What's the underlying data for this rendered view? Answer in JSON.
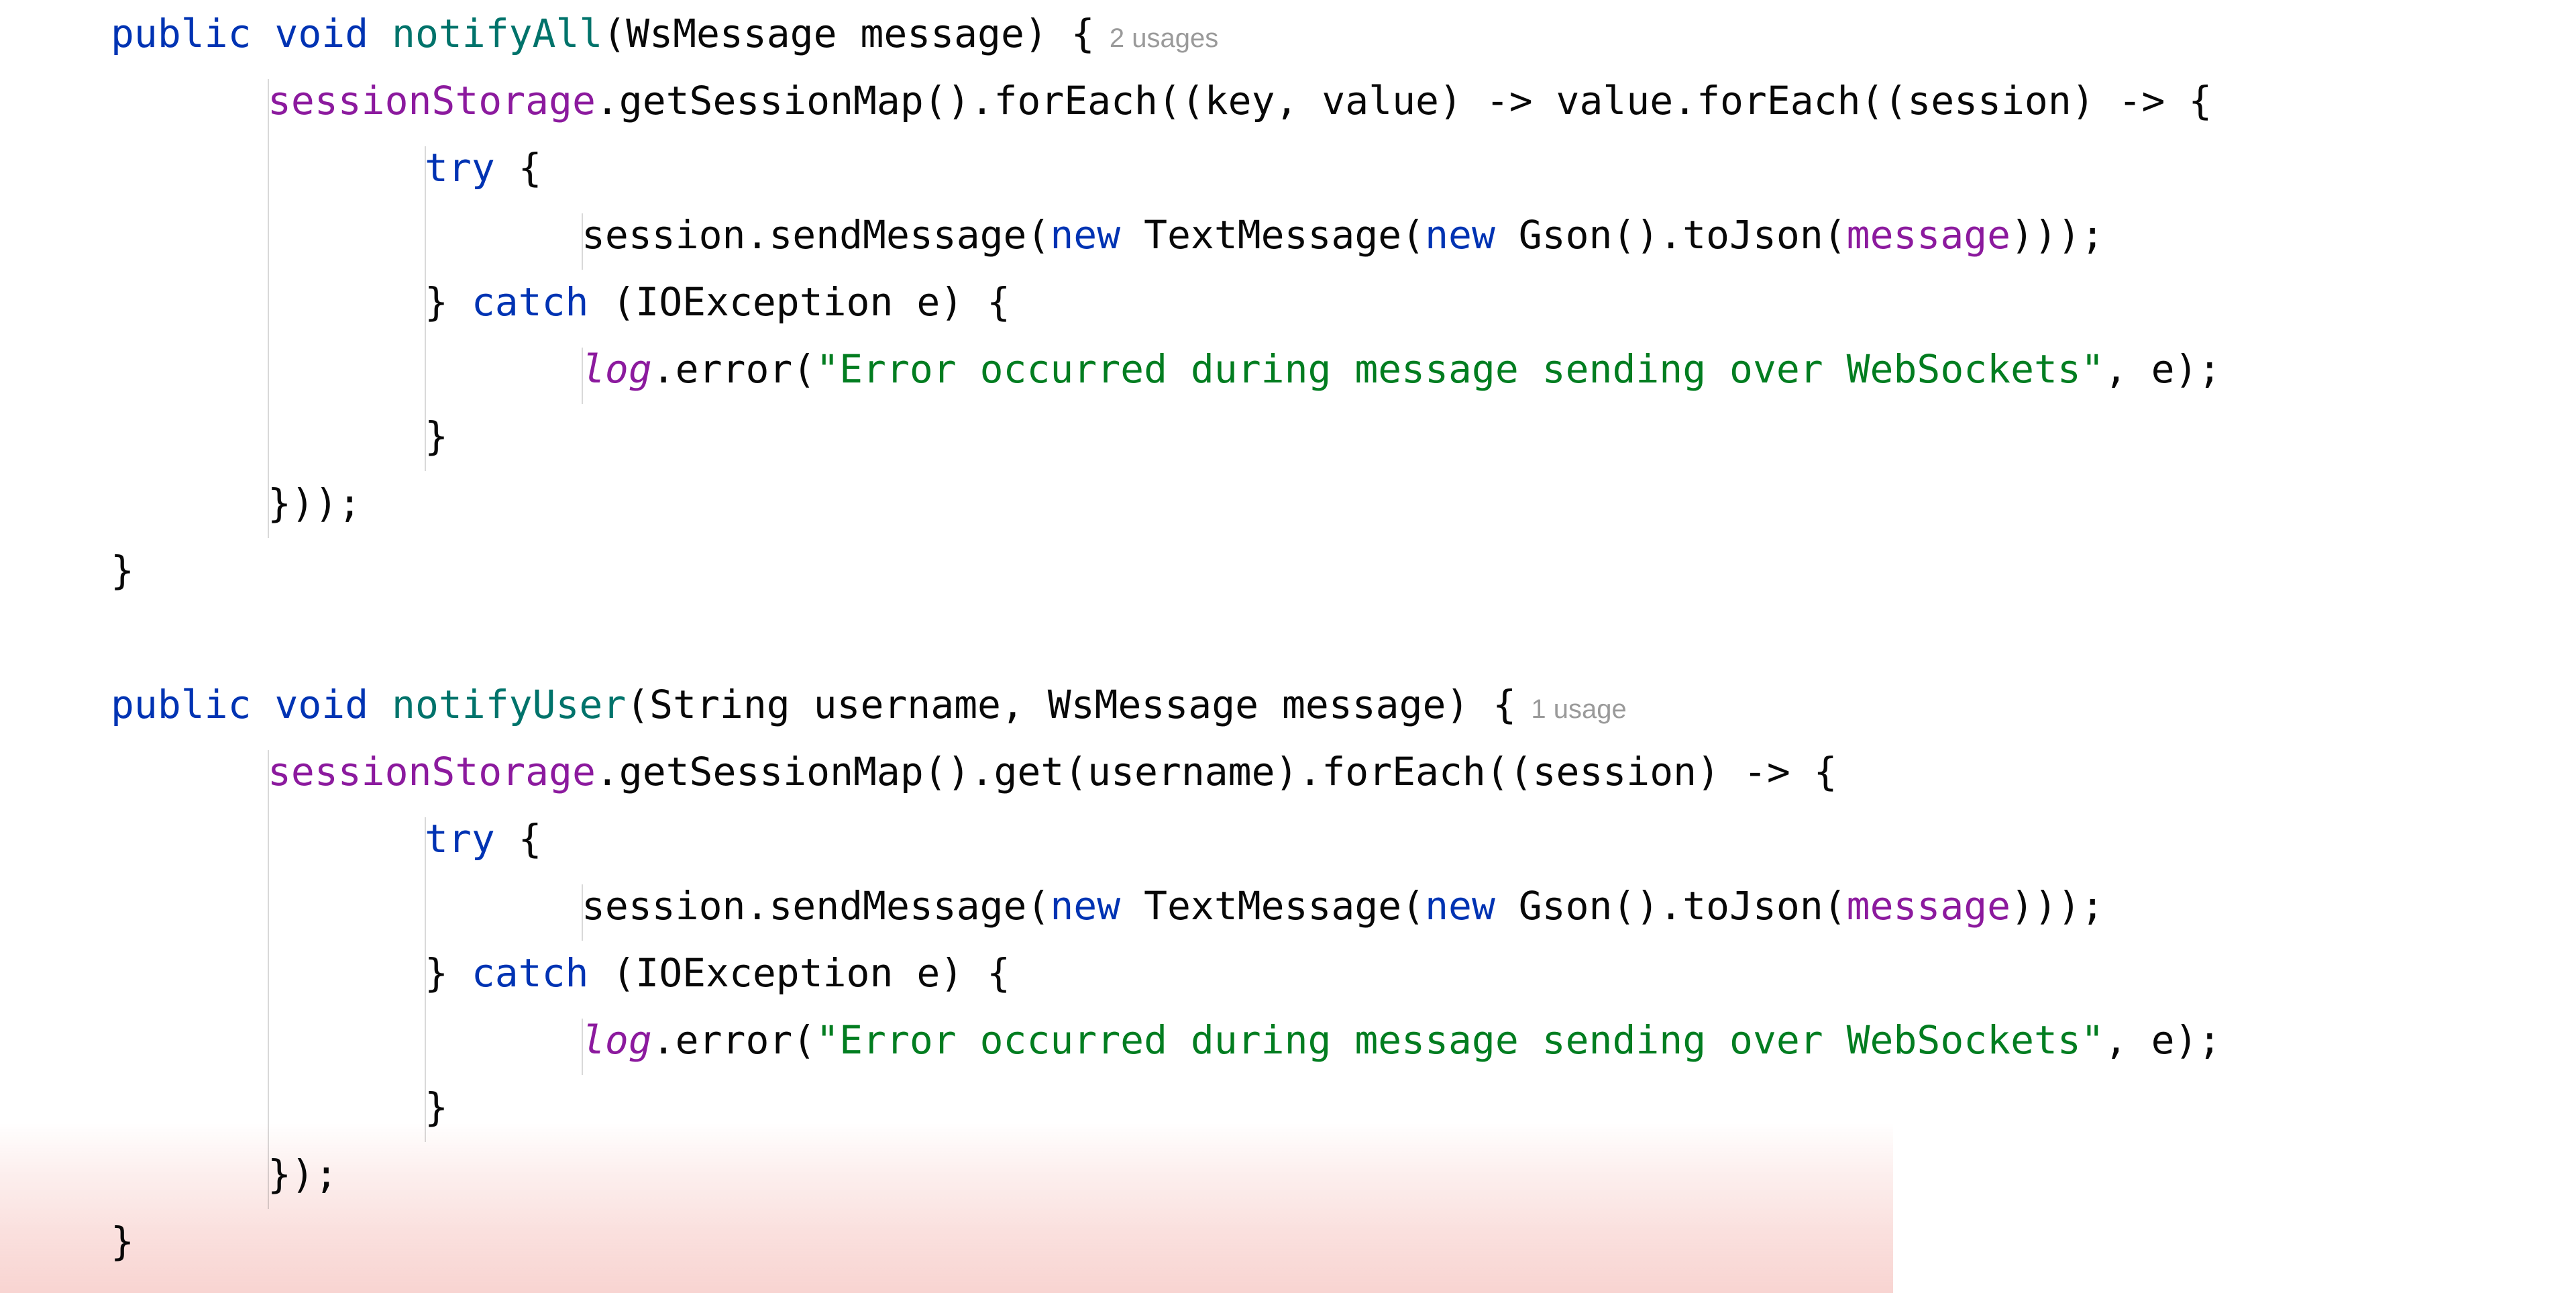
{
  "editor": {
    "background_color": "#ffffff",
    "default_text_color": "#080808",
    "indent_guide_color": "#d9d9d9",
    "syntax_colors": {
      "keyword": "#0033b3",
      "method_declaration": "#00736b",
      "field": "#8c1a9e",
      "static_field": "#8c1a9e",
      "string": "#027d20",
      "plain": "#080808",
      "inlay_hint": "#9a9a9a"
    },
    "overlay": {
      "name": "pink-gradient-highlight",
      "top_color": "#ffffff",
      "bottom_color": "#f8d4d1"
    }
  },
  "code": {
    "lines": [
      {
        "id": "line-1",
        "indent": 0,
        "tokens": [
          {
            "t": "public",
            "c": "kw"
          },
          {
            "t": " ",
            "c": "plain"
          },
          {
            "t": "void",
            "c": "kw"
          },
          {
            "t": " ",
            "c": "plain"
          },
          {
            "t": "notifyAll",
            "c": "method"
          },
          {
            "t": "(WsMessage message) {",
            "c": "plain"
          }
        ],
        "hint": "2 usages"
      },
      {
        "id": "line-2",
        "indent": 1,
        "tokens": [
          {
            "t": "sessionStorage",
            "c": "field"
          },
          {
            "t": ".getSessionMap().forEach((key, value) -> value.forEach((session) -> {",
            "c": "plain"
          }
        ],
        "hint": ""
      },
      {
        "id": "line-3",
        "indent": 2,
        "tokens": [
          {
            "t": "try",
            "c": "kw"
          },
          {
            "t": " {",
            "c": "plain"
          }
        ],
        "hint": ""
      },
      {
        "id": "line-4",
        "indent": 3,
        "tokens": [
          {
            "t": "session.sendMessage(",
            "c": "plain"
          },
          {
            "t": "new",
            "c": "kw"
          },
          {
            "t": " TextMessage(",
            "c": "plain"
          },
          {
            "t": "new",
            "c": "kw"
          },
          {
            "t": " Gson().toJson(",
            "c": "plain"
          },
          {
            "t": "message",
            "c": "field"
          },
          {
            "t": ")));",
            "c": "plain"
          }
        ],
        "hint": ""
      },
      {
        "id": "line-5",
        "indent": 2,
        "tokens": [
          {
            "t": "} ",
            "c": "plain"
          },
          {
            "t": "catch",
            "c": "kw"
          },
          {
            "t": " (IOException e) {",
            "c": "plain"
          }
        ],
        "hint": ""
      },
      {
        "id": "line-6",
        "indent": 3,
        "tokens": [
          {
            "t": "log",
            "c": "sfield"
          },
          {
            "t": ".error(",
            "c": "plain"
          },
          {
            "t": "\"Error occurred during message sending over WebSockets\"",
            "c": "str"
          },
          {
            "t": ", e);",
            "c": "plain"
          }
        ],
        "hint": ""
      },
      {
        "id": "line-7",
        "indent": 2,
        "tokens": [
          {
            "t": "}",
            "c": "plain"
          }
        ],
        "hint": ""
      },
      {
        "id": "line-8",
        "indent": 1,
        "tokens": [
          {
            "t": "}));",
            "c": "plain"
          }
        ],
        "hint": ""
      },
      {
        "id": "line-9",
        "indent": 0,
        "tokens": [
          {
            "t": "}",
            "c": "plain"
          }
        ],
        "hint": ""
      },
      {
        "id": "line-10",
        "indent": 0,
        "tokens": [],
        "hint": ""
      },
      {
        "id": "line-11",
        "indent": 0,
        "tokens": [
          {
            "t": "public",
            "c": "kw"
          },
          {
            "t": " ",
            "c": "plain"
          },
          {
            "t": "void",
            "c": "kw"
          },
          {
            "t": " ",
            "c": "plain"
          },
          {
            "t": "notifyUser",
            "c": "method"
          },
          {
            "t": "(String username, WsMessage message) {",
            "c": "plain"
          }
        ],
        "hint": "1 usage"
      },
      {
        "id": "line-12",
        "indent": 1,
        "tokens": [
          {
            "t": "sessionStorage",
            "c": "field"
          },
          {
            "t": ".getSessionMap().get(username).forEach((session) -> {",
            "c": "plain"
          }
        ],
        "hint": ""
      },
      {
        "id": "line-13",
        "indent": 2,
        "tokens": [
          {
            "t": "try",
            "c": "kw"
          },
          {
            "t": " {",
            "c": "plain"
          }
        ],
        "hint": ""
      },
      {
        "id": "line-14",
        "indent": 3,
        "tokens": [
          {
            "t": "session.sendMessage(",
            "c": "plain"
          },
          {
            "t": "new",
            "c": "kw"
          },
          {
            "t": " TextMessage(",
            "c": "plain"
          },
          {
            "t": "new",
            "c": "kw"
          },
          {
            "t": " Gson().toJson(",
            "c": "plain"
          },
          {
            "t": "message",
            "c": "field"
          },
          {
            "t": ")));",
            "c": "plain"
          }
        ],
        "hint": ""
      },
      {
        "id": "line-15",
        "indent": 2,
        "tokens": [
          {
            "t": "} ",
            "c": "plain"
          },
          {
            "t": "catch",
            "c": "kw"
          },
          {
            "t": " (IOException e) {",
            "c": "plain"
          }
        ],
        "hint": ""
      },
      {
        "id": "line-16",
        "indent": 3,
        "tokens": [
          {
            "t": "log",
            "c": "sfield"
          },
          {
            "t": ".error(",
            "c": "plain"
          },
          {
            "t": "\"Error occurred during message sending over WebSockets\"",
            "c": "str"
          },
          {
            "t": ", e);",
            "c": "plain"
          }
        ],
        "hint": ""
      },
      {
        "id": "line-17",
        "indent": 2,
        "tokens": [
          {
            "t": "}",
            "c": "plain"
          }
        ],
        "hint": ""
      },
      {
        "id": "line-18",
        "indent": 1,
        "tokens": [
          {
            "t": "});",
            "c": "plain"
          }
        ],
        "hint": ""
      },
      {
        "id": "line-19",
        "indent": 0,
        "tokens": [
          {
            "t": "}",
            "c": "plain"
          }
        ],
        "hint": ""
      }
    ]
  }
}
